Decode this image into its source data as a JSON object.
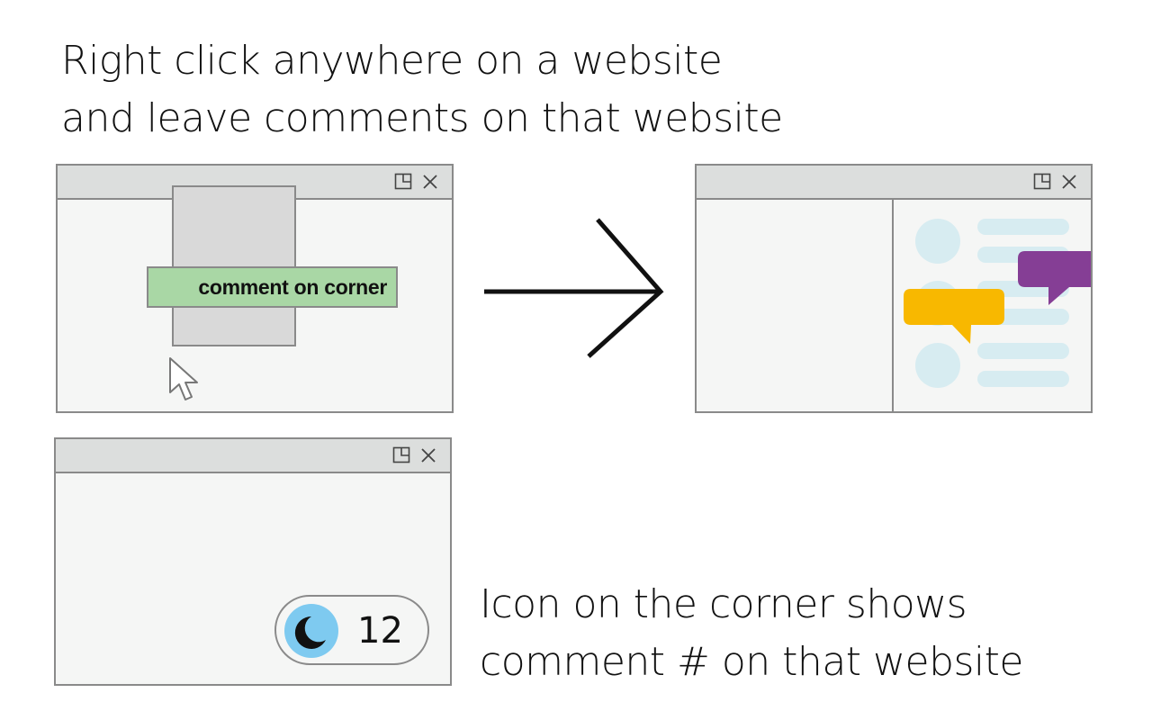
{
  "headline": {
    "line1": "Right click anywhere on a website",
    "line2": "and leave comments on that website"
  },
  "caption": {
    "line1": "Icon on the corner shows",
    "line2": "comment # on that website"
  },
  "window_controls": {
    "restore_icon": "restore-icon",
    "close_icon": "close-icon"
  },
  "context_menu": {
    "item_label": "comment on corner",
    "item_color": "#a9d7a5"
  },
  "comment_bubbles": {
    "yellow_color": "#f8b800",
    "purple_color": "#853e95"
  },
  "corner_badge": {
    "count": "12",
    "icon": "moon-icon",
    "icon_background": "#7ecaf0"
  }
}
